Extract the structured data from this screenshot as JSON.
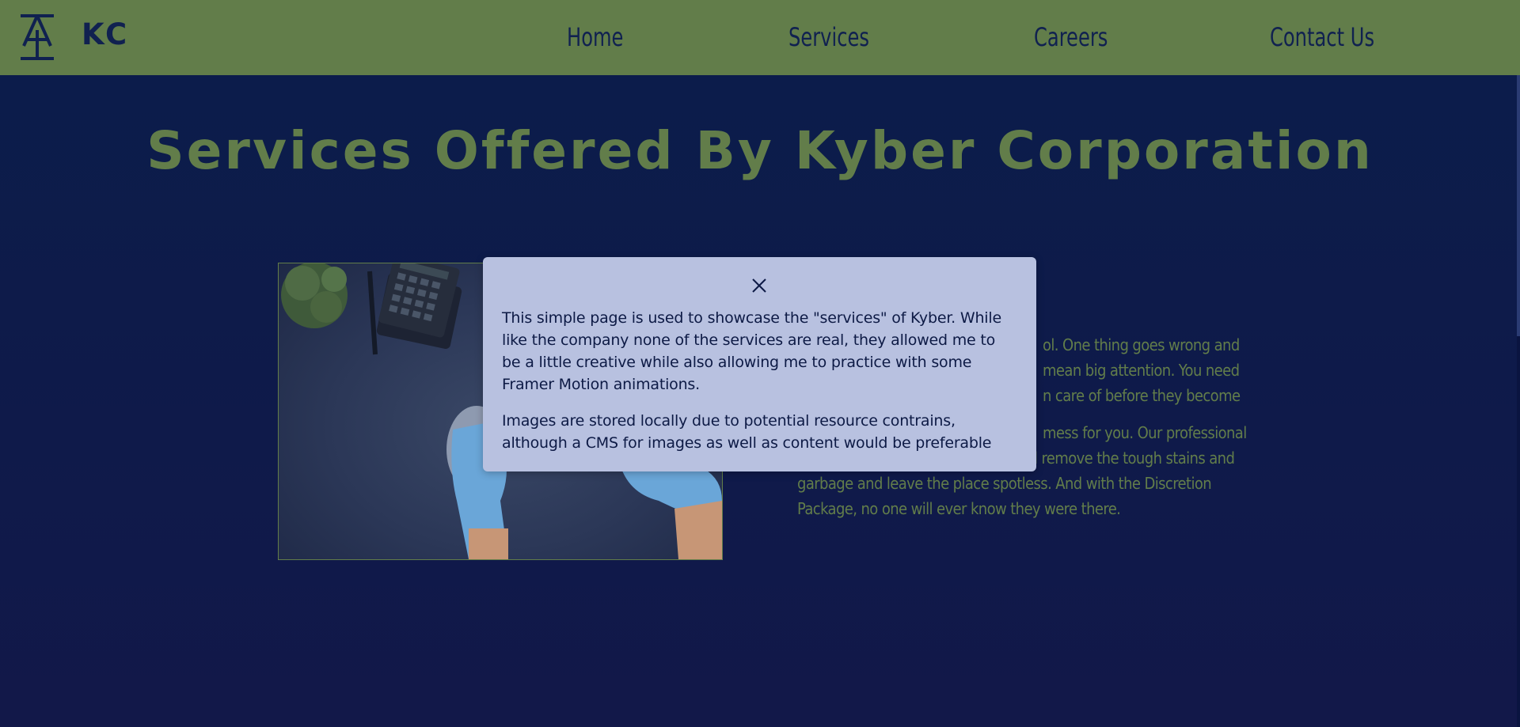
{
  "header": {
    "brand": "KC",
    "logo_icon": "kyber-monogram-logo-icon",
    "nav": [
      {
        "label": "Home"
      },
      {
        "label": "Services"
      },
      {
        "label": "Careers"
      },
      {
        "label": "Contact Us"
      }
    ]
  },
  "main": {
    "title": "Services Offered By Kyber Corporation",
    "image_icon": "cleaning-gloves-desk-photo",
    "paragraphs": [
      "ol. One thing goes wrong and",
      "mean big attention. You need",
      "n care of before they become",
      "mess for you. Our professional Cleaners can go to any location and remove the tough stains and garbage and leave the place spotless. And with the Discretion Package, no one will ever know they were there."
    ]
  },
  "modal": {
    "close_icon": "close-icon",
    "paragraphs": [
      "This simple page is used to showcase the \"services\" of Kyber. While like the company none of the services are real, they allowed me to be a little creative while also allowing me to practice with some Framer Motion animations.",
      "Images are stored locally due to potential resource contrains, although a CMS for images as well as content would be preferable"
    ]
  },
  "colors": {
    "header_bg": "#627d4a",
    "page_bg": "#0e1a4a",
    "accent_green": "#627d4a",
    "modal_bg": "#b8c1e0",
    "nav_text": "#102150"
  }
}
